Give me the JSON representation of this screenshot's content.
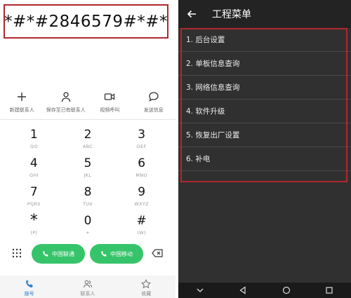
{
  "dialer": {
    "input_value": "*#*#2846579#*#*",
    "actions": [
      {
        "icon": "plus-icon",
        "label": "新建联系人"
      },
      {
        "icon": "person-icon",
        "label": "保存至已有联系人"
      },
      {
        "icon": "video-icon",
        "label": "视频呼叫"
      },
      {
        "icon": "message-icon",
        "label": "发送信息"
      }
    ],
    "keys": [
      {
        "num": "1",
        "sub": "QO"
      },
      {
        "num": "2",
        "sub": "ABC"
      },
      {
        "num": "3",
        "sub": "DEF"
      },
      {
        "num": "4",
        "sub": "GHI"
      },
      {
        "num": "5",
        "sub": "JKL"
      },
      {
        "num": "6",
        "sub": "MNO"
      },
      {
        "num": "7",
        "sub": "PQRS"
      },
      {
        "num": "8",
        "sub": "TUV"
      },
      {
        "num": "9",
        "sub": "WXYZ"
      },
      {
        "num": "*",
        "sub": "(P)"
      },
      {
        "num": "0",
        "sub": "+"
      },
      {
        "num": "#",
        "sub": "(W)"
      }
    ],
    "call_buttons": [
      {
        "label": "中国联通",
        "sim": "1"
      },
      {
        "label": "中国移动",
        "sim": "HD"
      }
    ],
    "bottom_nav": [
      {
        "icon": "phone-icon",
        "label": "拨号",
        "active": true
      },
      {
        "icon": "contacts-icon",
        "label": "联系人",
        "active": false
      },
      {
        "icon": "star-icon",
        "label": "收藏",
        "active": false
      }
    ]
  },
  "menu": {
    "title": "工程菜单",
    "items": [
      "1. 后台设置",
      "2. 单板信息查询",
      "3. 网络信息查询",
      "4. 软件升级",
      "5. 恢复出厂设置",
      "6. 补电"
    ]
  },
  "colors": {
    "highlight_border": "#b0282c",
    "call_green": "#36c46a",
    "active_blue": "#2f7fd0",
    "menu_bg": "#303030"
  }
}
